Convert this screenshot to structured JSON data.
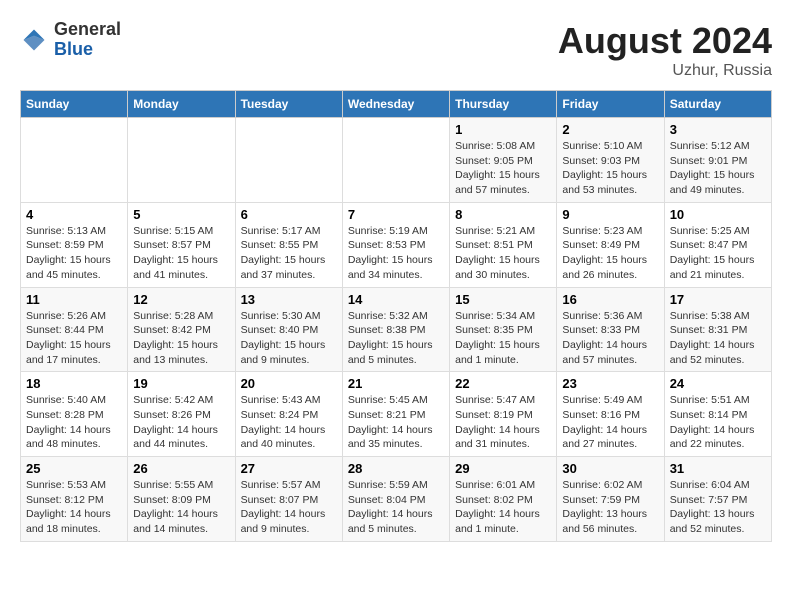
{
  "header": {
    "logo": {
      "general": "General",
      "blue": "Blue"
    },
    "month_year": "August 2024",
    "location": "Uzhur, Russia"
  },
  "calendar": {
    "days_of_week": [
      "Sunday",
      "Monday",
      "Tuesday",
      "Wednesday",
      "Thursday",
      "Friday",
      "Saturday"
    ],
    "weeks": [
      [
        {
          "day": "",
          "info": ""
        },
        {
          "day": "",
          "info": ""
        },
        {
          "day": "",
          "info": ""
        },
        {
          "day": "",
          "info": ""
        },
        {
          "day": "1",
          "info": "Sunrise: 5:08 AM\nSunset: 9:05 PM\nDaylight: 15 hours\nand 57 minutes."
        },
        {
          "day": "2",
          "info": "Sunrise: 5:10 AM\nSunset: 9:03 PM\nDaylight: 15 hours\nand 53 minutes."
        },
        {
          "day": "3",
          "info": "Sunrise: 5:12 AM\nSunset: 9:01 PM\nDaylight: 15 hours\nand 49 minutes."
        }
      ],
      [
        {
          "day": "4",
          "info": "Sunrise: 5:13 AM\nSunset: 8:59 PM\nDaylight: 15 hours\nand 45 minutes."
        },
        {
          "day": "5",
          "info": "Sunrise: 5:15 AM\nSunset: 8:57 PM\nDaylight: 15 hours\nand 41 minutes."
        },
        {
          "day": "6",
          "info": "Sunrise: 5:17 AM\nSunset: 8:55 PM\nDaylight: 15 hours\nand 37 minutes."
        },
        {
          "day": "7",
          "info": "Sunrise: 5:19 AM\nSunset: 8:53 PM\nDaylight: 15 hours\nand 34 minutes."
        },
        {
          "day": "8",
          "info": "Sunrise: 5:21 AM\nSunset: 8:51 PM\nDaylight: 15 hours\nand 30 minutes."
        },
        {
          "day": "9",
          "info": "Sunrise: 5:23 AM\nSunset: 8:49 PM\nDaylight: 15 hours\nand 26 minutes."
        },
        {
          "day": "10",
          "info": "Sunrise: 5:25 AM\nSunset: 8:47 PM\nDaylight: 15 hours\nand 21 minutes."
        }
      ],
      [
        {
          "day": "11",
          "info": "Sunrise: 5:26 AM\nSunset: 8:44 PM\nDaylight: 15 hours\nand 17 minutes."
        },
        {
          "day": "12",
          "info": "Sunrise: 5:28 AM\nSunset: 8:42 PM\nDaylight: 15 hours\nand 13 minutes."
        },
        {
          "day": "13",
          "info": "Sunrise: 5:30 AM\nSunset: 8:40 PM\nDaylight: 15 hours\nand 9 minutes."
        },
        {
          "day": "14",
          "info": "Sunrise: 5:32 AM\nSunset: 8:38 PM\nDaylight: 15 hours\nand 5 minutes."
        },
        {
          "day": "15",
          "info": "Sunrise: 5:34 AM\nSunset: 8:35 PM\nDaylight: 15 hours\nand 1 minute."
        },
        {
          "day": "16",
          "info": "Sunrise: 5:36 AM\nSunset: 8:33 PM\nDaylight: 14 hours\nand 57 minutes."
        },
        {
          "day": "17",
          "info": "Sunrise: 5:38 AM\nSunset: 8:31 PM\nDaylight: 14 hours\nand 52 minutes."
        }
      ],
      [
        {
          "day": "18",
          "info": "Sunrise: 5:40 AM\nSunset: 8:28 PM\nDaylight: 14 hours\nand 48 minutes."
        },
        {
          "day": "19",
          "info": "Sunrise: 5:42 AM\nSunset: 8:26 PM\nDaylight: 14 hours\nand 44 minutes."
        },
        {
          "day": "20",
          "info": "Sunrise: 5:43 AM\nSunset: 8:24 PM\nDaylight: 14 hours\nand 40 minutes."
        },
        {
          "day": "21",
          "info": "Sunrise: 5:45 AM\nSunset: 8:21 PM\nDaylight: 14 hours\nand 35 minutes."
        },
        {
          "day": "22",
          "info": "Sunrise: 5:47 AM\nSunset: 8:19 PM\nDaylight: 14 hours\nand 31 minutes."
        },
        {
          "day": "23",
          "info": "Sunrise: 5:49 AM\nSunset: 8:16 PM\nDaylight: 14 hours\nand 27 minutes."
        },
        {
          "day": "24",
          "info": "Sunrise: 5:51 AM\nSunset: 8:14 PM\nDaylight: 14 hours\nand 22 minutes."
        }
      ],
      [
        {
          "day": "25",
          "info": "Sunrise: 5:53 AM\nSunset: 8:12 PM\nDaylight: 14 hours\nand 18 minutes."
        },
        {
          "day": "26",
          "info": "Sunrise: 5:55 AM\nSunset: 8:09 PM\nDaylight: 14 hours\nand 14 minutes."
        },
        {
          "day": "27",
          "info": "Sunrise: 5:57 AM\nSunset: 8:07 PM\nDaylight: 14 hours\nand 9 minutes."
        },
        {
          "day": "28",
          "info": "Sunrise: 5:59 AM\nSunset: 8:04 PM\nDaylight: 14 hours\nand 5 minutes."
        },
        {
          "day": "29",
          "info": "Sunrise: 6:01 AM\nSunset: 8:02 PM\nDaylight: 14 hours\nand 1 minute."
        },
        {
          "day": "30",
          "info": "Sunrise: 6:02 AM\nSunset: 7:59 PM\nDaylight: 13 hours\nand 56 minutes."
        },
        {
          "day": "31",
          "info": "Sunrise: 6:04 AM\nSunset: 7:57 PM\nDaylight: 13 hours\nand 52 minutes."
        }
      ]
    ]
  }
}
